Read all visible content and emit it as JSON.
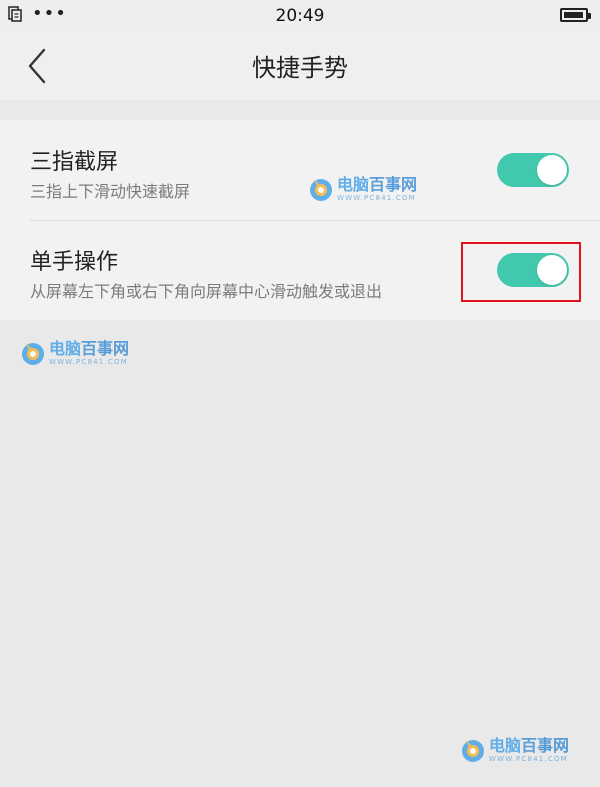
{
  "status_bar": {
    "time": "20:49",
    "dots": "•••",
    "battery_level": 0.95
  },
  "nav": {
    "title": "快捷手势"
  },
  "settings": [
    {
      "title": "三指截屏",
      "subtitle": "三指上下滑动快速截屏",
      "enabled": true
    },
    {
      "title": "单手操作",
      "subtitle": "从屏幕左下角或右下角向屏幕中心滑动触发或退出",
      "enabled": true
    }
  ],
  "watermark": {
    "name_a": "电脑",
    "name_b": "百事网",
    "url": "WWW.PC841.COM"
  },
  "colors": {
    "toggle_on": "#42c9ad",
    "highlight": "#e0141b",
    "watermark": "#4aa3e8"
  },
  "icons": {
    "back": "chevron-left-icon",
    "status_doc": "document-icon",
    "battery": "battery-icon"
  }
}
